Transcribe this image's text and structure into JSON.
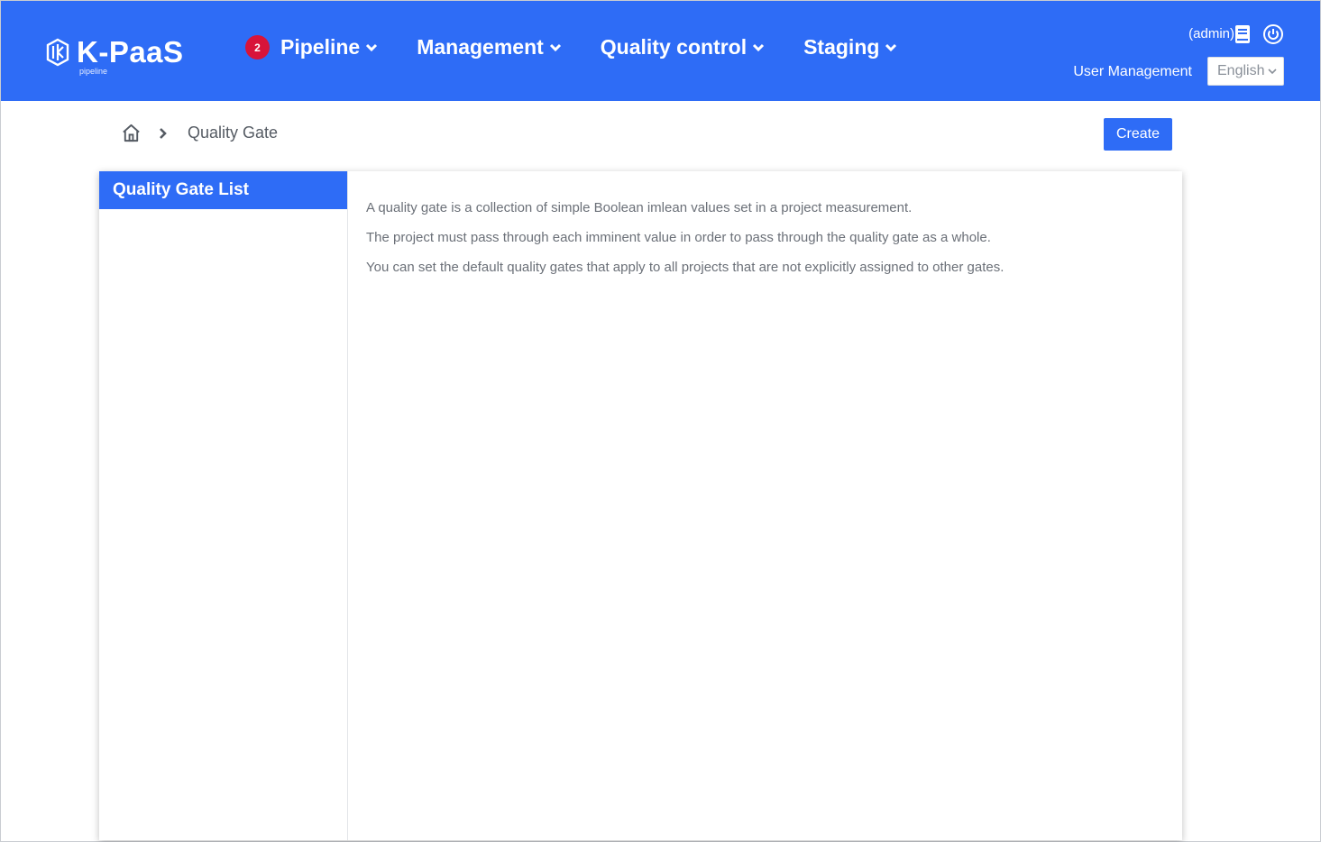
{
  "brand": {
    "name": "K-PaaS",
    "sub": "pipeline"
  },
  "nav": {
    "items": [
      {
        "label": "Pipeline",
        "badge": "2"
      },
      {
        "label": "Management"
      },
      {
        "label": "Quality control"
      },
      {
        "label": "Staging"
      }
    ]
  },
  "user": {
    "name": "(admin)",
    "management_label": "User Management",
    "language": "English"
  },
  "breadcrumb": {
    "current": "Quality Gate"
  },
  "actions": {
    "create_label": "Create"
  },
  "sidebar": {
    "title": "Quality Gate List"
  },
  "description": [
    "A quality gate is a collection of simple Boolean imlean values set in a project measurement.",
    "The project must pass through each imminent value in order to pass through the quality gate as a whole.",
    "You can set the default quality gates that apply to all projects that are not explicitly assigned to other gates."
  ],
  "colors": {
    "primary": "#2e6cf6",
    "badge": "#d8143a"
  },
  "icons": [
    "k-paas-logo-icon",
    "chevron-down-icon",
    "book-icon",
    "power-icon",
    "home-icon",
    "chevron-right-icon"
  ]
}
